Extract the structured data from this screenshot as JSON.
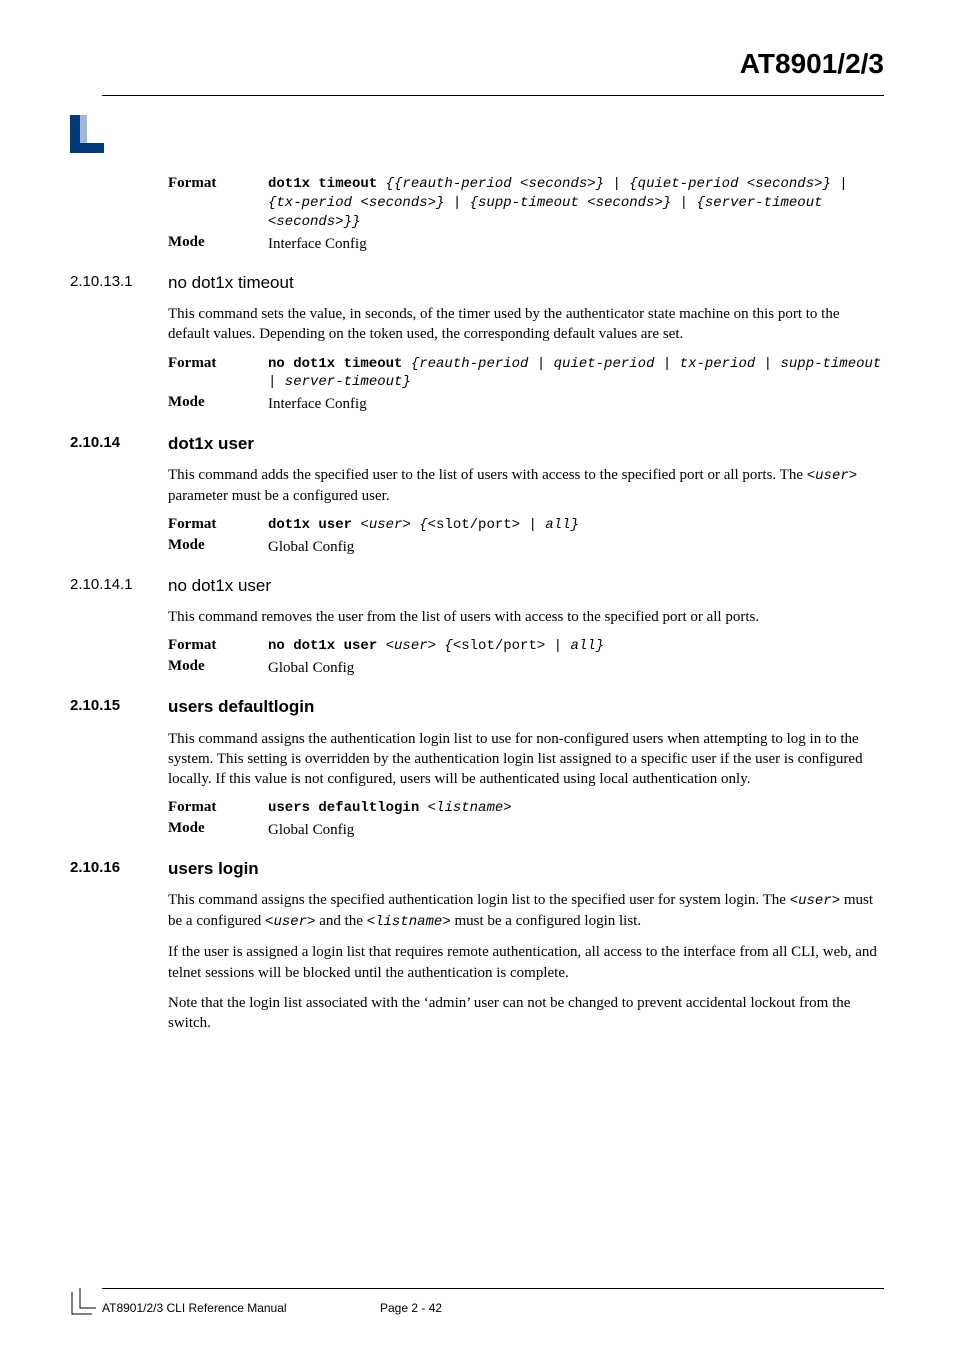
{
  "header": {
    "title": "AT8901/2/3"
  },
  "section_top": {
    "format_label": "Format",
    "format_cmd": "dot1x timeout ",
    "format_args": "{{reauth-period <seconds>} | {quiet-period <seconds>} | {tx-period <seconds>} | {supp-timeout <seconds>} | {server-timeout <seconds>}}",
    "mode_label": "Mode",
    "mode_value": "Interface Config"
  },
  "s_2_10_13_1": {
    "num": "2.10.13.1",
    "title": "no dot1x timeout",
    "para": "This command sets the value, in seconds, of the timer used by the authenticator state machine on this port to the default values. Depending on the token used, the corresponding default values are set.",
    "format_label": "Format",
    "format_cmd": "no dot1x timeout ",
    "format_args": "{reauth-period | quiet-period | tx-period | supp-timeout | server-timeout}",
    "mode_label": "Mode",
    "mode_value": "Interface Config"
  },
  "s_2_10_14": {
    "num": "2.10.14",
    "title": "dot1x user",
    "para_pre": "This command adds the specified user to the list of users with access to the specified port or all ports. The ",
    "para_code": "<user>",
    "para_post": " parameter must be a configured user.",
    "format_label": "Format",
    "format_cmd": "dot1x user ",
    "format_arg1": "<user> {<",
    "format_mid": "slot/port",
    "format_arg2": "> | all}",
    "mode_label": "Mode",
    "mode_value": "Global Config"
  },
  "s_2_10_14_1": {
    "num": "2.10.14.1",
    "title": "no dot1x user",
    "para": "This command removes the user from the list of users with access to the specified port or all ports.",
    "format_label": "Format",
    "format_cmd": "no dot1x user ",
    "format_arg1": "<user> {<",
    "format_mid": "slot/port",
    "format_arg2": "> | all}",
    "mode_label": "Mode",
    "mode_value": "Global Config"
  },
  "s_2_10_15": {
    "num": "2.10.15",
    "title": "users defaultlogin",
    "para": "This command assigns the authentication login list to use for non-configured users when attempting to log in to the system. This setting is overridden by the authentication login list assigned to a specific user if the user is configured locally. If this value is not configured, users will be authenticated using local authentication only.",
    "format_label": "Format",
    "format_cmd": "users defaultlogin ",
    "format_args": "<listname>",
    "mode_label": "Mode",
    "mode_value": "Global Config"
  },
  "s_2_10_16": {
    "num": "2.10.16",
    "title": "users login",
    "para1_a": "This command assigns the specified authentication login list to the specified user for system login. The ",
    "para1_c1": "<user>",
    "para1_b": " must be a configured ",
    "para1_c2": "<user>",
    "para1_c": " and the ",
    "para1_c3": "<listname>",
    "para1_d": " must be a configured login list.",
    "para2": "If the user is assigned a login list that requires remote authentication, all access to the interface from all CLI, web, and telnet sessions will be blocked until the authentication is complete.",
    "para3": "Note that the login list associated with the ‘admin’ user can not be changed to prevent accidental lockout from the switch."
  },
  "footer": {
    "left": "AT8901/2/3 CLI Reference Manual",
    "page": "Page 2 - 42"
  }
}
